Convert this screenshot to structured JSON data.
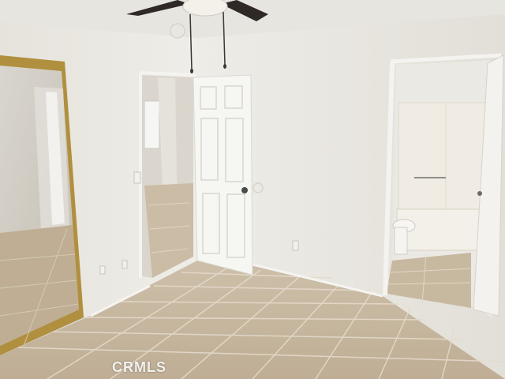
{
  "photo": {
    "watermark_text": "CRMLS"
  }
}
